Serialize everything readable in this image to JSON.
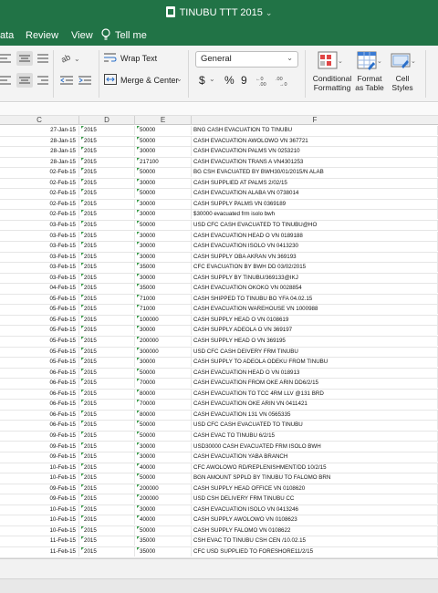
{
  "window": {
    "title": "TINUBU TTT 2015"
  },
  "tabs": {
    "data_partial": "ata",
    "review": "Review",
    "view": "View",
    "tell_me": "Tell me"
  },
  "ribbon": {
    "wrap_text": "Wrap Text",
    "merge_center": "Merge & Center",
    "number_format": "General",
    "currency_symbol": "$",
    "percent_symbol": "%",
    "comma_symbol": "9",
    "conditional_formatting_line1": "Conditional",
    "conditional_formatting_line2": "Formatting",
    "format_as_table_line1": "Format",
    "format_as_table_line2": "as Table",
    "cell_styles_line1": "Cell",
    "cell_styles_line2": "Styles"
  },
  "columns": [
    "C",
    "D",
    "E",
    "F"
  ],
  "rows": [
    {
      "date": "27-Jan-15",
      "year": "2015",
      "amount": "50000",
      "desc": "BNG CASH EVACUATION TO TINUBU"
    },
    {
      "date": "28-Jan-15",
      "year": "2015",
      "amount": "50000",
      "desc": "CASH EVACUATION AWOLOWO VN 367721"
    },
    {
      "date": "28-Jan-15",
      "year": "2015",
      "amount": "30000",
      "desc": "CASH EVACUATION PALMS VN 0253210"
    },
    {
      "date": "28-Jan-15",
      "year": "2015",
      "amount": "217100",
      "desc": "CASH EVACUATION TRANS A VN4301253"
    },
    {
      "date": "02-Feb-15",
      "year": "2015",
      "amount": "50000",
      "desc": "BG CSH EVACUATED BY BWH30/01/2015/N ALAB"
    },
    {
      "date": "02-Feb-15",
      "year": "2015",
      "amount": "30000",
      "desc": "CASH SUPPLIED AT PALMS 2/02/15"
    },
    {
      "date": "02-Feb-15",
      "year": "2015",
      "amount": "50000",
      "desc": "CASH EVACUATION ALABA VN 0738014"
    },
    {
      "date": "02-Feb-15",
      "year": "2015",
      "amount": "30000",
      "desc": "CASH SUPPLY PALMS VN 0369189"
    },
    {
      "date": "02-Feb-15",
      "year": "2015",
      "amount": "30000",
      "desc": "$30000 evacuated frm isolo bwh"
    },
    {
      "date": "03-Feb-15",
      "year": "2015",
      "amount": "50000",
      "desc": "USD CFC CASH EVACUATED TO TINUBU@HO"
    },
    {
      "date": "03-Feb-15",
      "year": "2015",
      "amount": "30000",
      "desc": "CASH EVACUATION HEAD O VN 0189188"
    },
    {
      "date": "03-Feb-15",
      "year": "2015",
      "amount": "30000",
      "desc": "CASH EVACUATION ISOLO VN 0413230"
    },
    {
      "date": "03-Feb-15",
      "year": "2015",
      "amount": "30000",
      "desc": "CASH SUPPLY OBA AKRAN VN 369193"
    },
    {
      "date": "03-Feb-15",
      "year": "2015",
      "amount": "35000",
      "desc": "CFC EVACUATION BY BWH DD 03/02/2015"
    },
    {
      "date": "03-Feb-15",
      "year": "2015",
      "amount": "30000",
      "desc": "CASH SUPPLY BY TINUBU/369133@IKJ"
    },
    {
      "date": "04-Feb-15",
      "year": "2015",
      "amount": "35000",
      "desc": "CASH EVACUATION OKOKO VN 0028854"
    },
    {
      "date": "05-Feb-15",
      "year": "2015",
      "amount": "71000",
      "desc": "CASH SHIPPED TO TINUBU BO YFA 04.02.15"
    },
    {
      "date": "05-Feb-15",
      "year": "2015",
      "amount": "71000",
      "desc": "CASH EVACUATION WAREHOUSE VN 1000988"
    },
    {
      "date": "05-Feb-15",
      "year": "2015",
      "amount": "100000",
      "desc": "CASH SUPPLY HEAD O VN 0108619"
    },
    {
      "date": "05-Feb-15",
      "year": "2015",
      "amount": "30000",
      "desc": "CASH SUPPLY ADEOLA O VN 369197"
    },
    {
      "date": "05-Feb-15",
      "year": "2015",
      "amount": "200000",
      "desc": "CASH SUPPLY HEAD O VN 369195"
    },
    {
      "date": "05-Feb-15",
      "year": "2015",
      "amount": "300000",
      "desc": "USD CFC CASH DEIVERY FRM TINUBU"
    },
    {
      "date": "05-Feb-15",
      "year": "2015",
      "amount": "30000",
      "desc": "CASH SUPPLY TO ADEOLA ODEKU FROM TINUBU"
    },
    {
      "date": "06-Feb-15",
      "year": "2015",
      "amount": "50000",
      "desc": "CASH EVACUATION HEAD O VN 018913"
    },
    {
      "date": "06-Feb-15",
      "year": "2015",
      "amount": "70000",
      "desc": "CASH EVACUATION FROM OKE ARIN DD6/2/15"
    },
    {
      "date": "06-Feb-15",
      "year": "2015",
      "amount": "80000",
      "desc": "CASH EVACUATION TO TCC 4RM LLV @131 BRD"
    },
    {
      "date": "06-Feb-15",
      "year": "2015",
      "amount": "70000",
      "desc": "CASH EVACUATION OKE ARIN VN 0411421"
    },
    {
      "date": "06-Feb-15",
      "year": "2015",
      "amount": "80000",
      "desc": "CASH EVACUATION 131 VN 0565335"
    },
    {
      "date": "06-Feb-15",
      "year": "2015",
      "amount": "50000",
      "desc": "USD CFC CASH EVACUATED TO TINUBU"
    },
    {
      "date": "09-Feb-15",
      "year": "2015",
      "amount": "50000",
      "desc": "CASH EVAC TO TINUBU 6/2/15"
    },
    {
      "date": "09-Feb-15",
      "year": "2015",
      "amount": "30000",
      "desc": "USD30000 CASH EVACUATED FRM ISOLO BWH"
    },
    {
      "date": "09-Feb-15",
      "year": "2015",
      "amount": "30000",
      "desc": "CASH EVACUATION YABA BRANCH"
    },
    {
      "date": "10-Feb-15",
      "year": "2015",
      "amount": "40000",
      "desc": "CFC AWOLOWO RD/REPLENISHMENT/DD 10/2/15"
    },
    {
      "date": "10-Feb-15",
      "year": "2015",
      "amount": "50000",
      "desc": "BGN AMOUNT SPPLD BY TINUBU TO FALOMO BRN"
    },
    {
      "date": "09-Feb-15",
      "year": "2015",
      "amount": "200000",
      "desc": "CASH SUPPLY HEAD OFFICE VN 0108620"
    },
    {
      "date": "09-Feb-15",
      "year": "2015",
      "amount": "200000",
      "desc": "USD CSH DELIVERY FRM TINUBU CC"
    },
    {
      "date": "10-Feb-15",
      "year": "2015",
      "amount": "30000",
      "desc": "CASH EVACUATION ISOLO VN 0413246"
    },
    {
      "date": "10-Feb-15",
      "year": "2015",
      "amount": "40000",
      "desc": "CASH SUPPLY AWOLOWO VN 0108623"
    },
    {
      "date": "10-Feb-15",
      "year": "2015",
      "amount": "50000",
      "desc": "CASH SUPPLY FALOMO VN 0108622"
    },
    {
      "date": "11-Feb-15",
      "year": "2015",
      "amount": "35000",
      "desc": "CSH EVAC TO TINUBU CSH CEN /10.02.15"
    },
    {
      "date": "11-Feb-15",
      "year": "2015",
      "amount": "35000",
      "desc": "CFC USD SUPPLIED TO FORESHORE11/2/15"
    }
  ],
  "colors": {
    "excel_green": "#217346",
    "number_triangle": "#3a9b4a"
  }
}
